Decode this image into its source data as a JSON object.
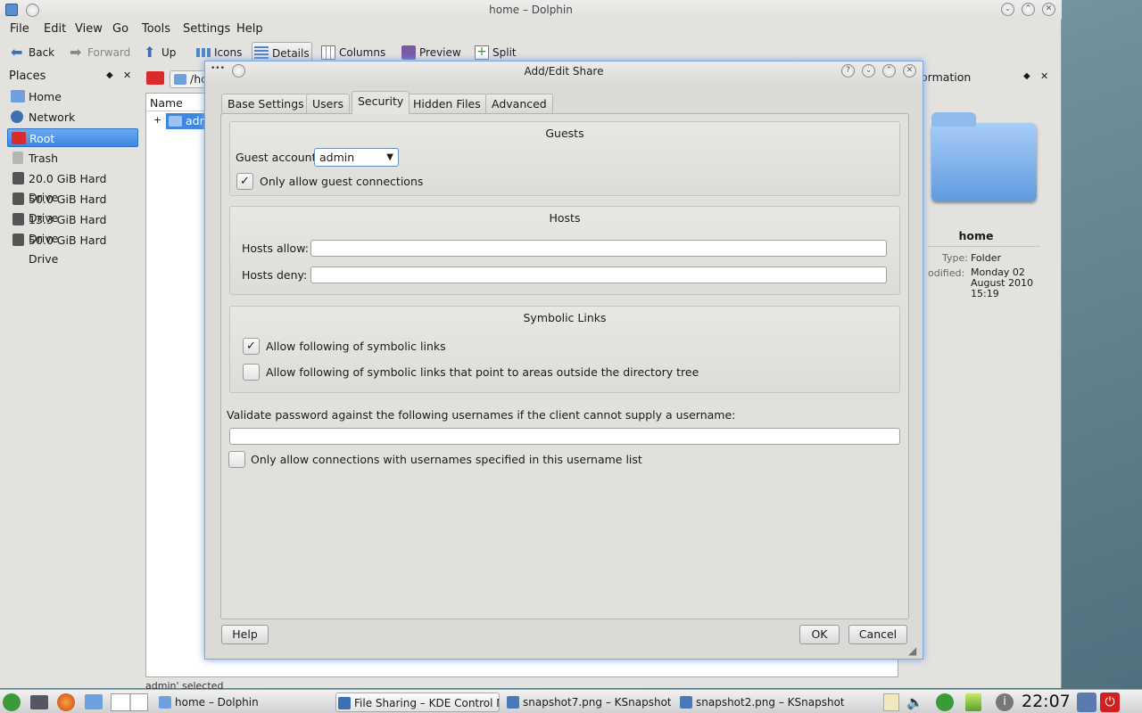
{
  "dolphin": {
    "title": "home – Dolphin",
    "menus": [
      "File",
      "Edit",
      "View",
      "Go",
      "Tools",
      "Settings",
      "Help"
    ],
    "toolbar": {
      "back": "Back",
      "forward": "Forward",
      "up": "Up",
      "icons": "Icons",
      "details": "Details",
      "columns": "Columns",
      "preview": "Preview",
      "split": "Split"
    },
    "places": {
      "header": "Places",
      "items": [
        "Home",
        "Network",
        "Root",
        "Trash",
        "20.0 GiB Hard Drive",
        "50.0 GiB Hard Drive",
        "13.3 GiB Hard Drive",
        "50.0 GiB Hard Drive"
      ]
    },
    "location": "/ho",
    "column_header": "Name",
    "file_item": "adm",
    "expander": "+",
    "info": {
      "header": "ormation",
      "name": "home",
      "type_label": "Type:",
      "type_value": "Folder",
      "modified_label": "odified:",
      "modified_value": "Monday 02 August 2010 15:19"
    },
    "status": "admin' selected"
  },
  "dialog": {
    "title": "Add/Edit Share",
    "tabs": [
      "Base Settings",
      "Users",
      "Security",
      "Hidden Files",
      "Advanced"
    ],
    "active_tab": "Security",
    "guests": {
      "title": "Guests",
      "account_label": "Guest account:",
      "account_value": "admin",
      "only_guest_label": "Only allow guest connections",
      "only_guest_checked": true
    },
    "hosts": {
      "title": "Hosts",
      "allow_label": "Hosts allow:",
      "allow_value": "",
      "deny_label": "Hosts deny:",
      "deny_value": ""
    },
    "symlinks": {
      "title": "Symbolic Links",
      "follow_label": "Allow following of symbolic links",
      "follow_checked": true,
      "outside_label": "Allow following of symbolic links that point to areas outside the directory tree",
      "outside_checked": false
    },
    "validate_label": "Validate password against the following usernames if the client cannot supply a username:",
    "validate_value": "",
    "only_users_label": "Only allow connections with usernames specified in this username list",
    "only_users_checked": false,
    "buttons": {
      "help": "Help",
      "ok": "OK",
      "cancel": "Cancel"
    },
    "check_glyph": "✓"
  },
  "taskbar": {
    "tasks": [
      "home – Dolphin",
      "File Sharing – KDE Control M",
      "snapshot7.png – KSnapshot",
      "snapshot2.png – KSnapshot"
    ],
    "clock": "22:07"
  },
  "colors": {
    "selection": "#3e86e0",
    "accent_border": "#7da8d8"
  }
}
